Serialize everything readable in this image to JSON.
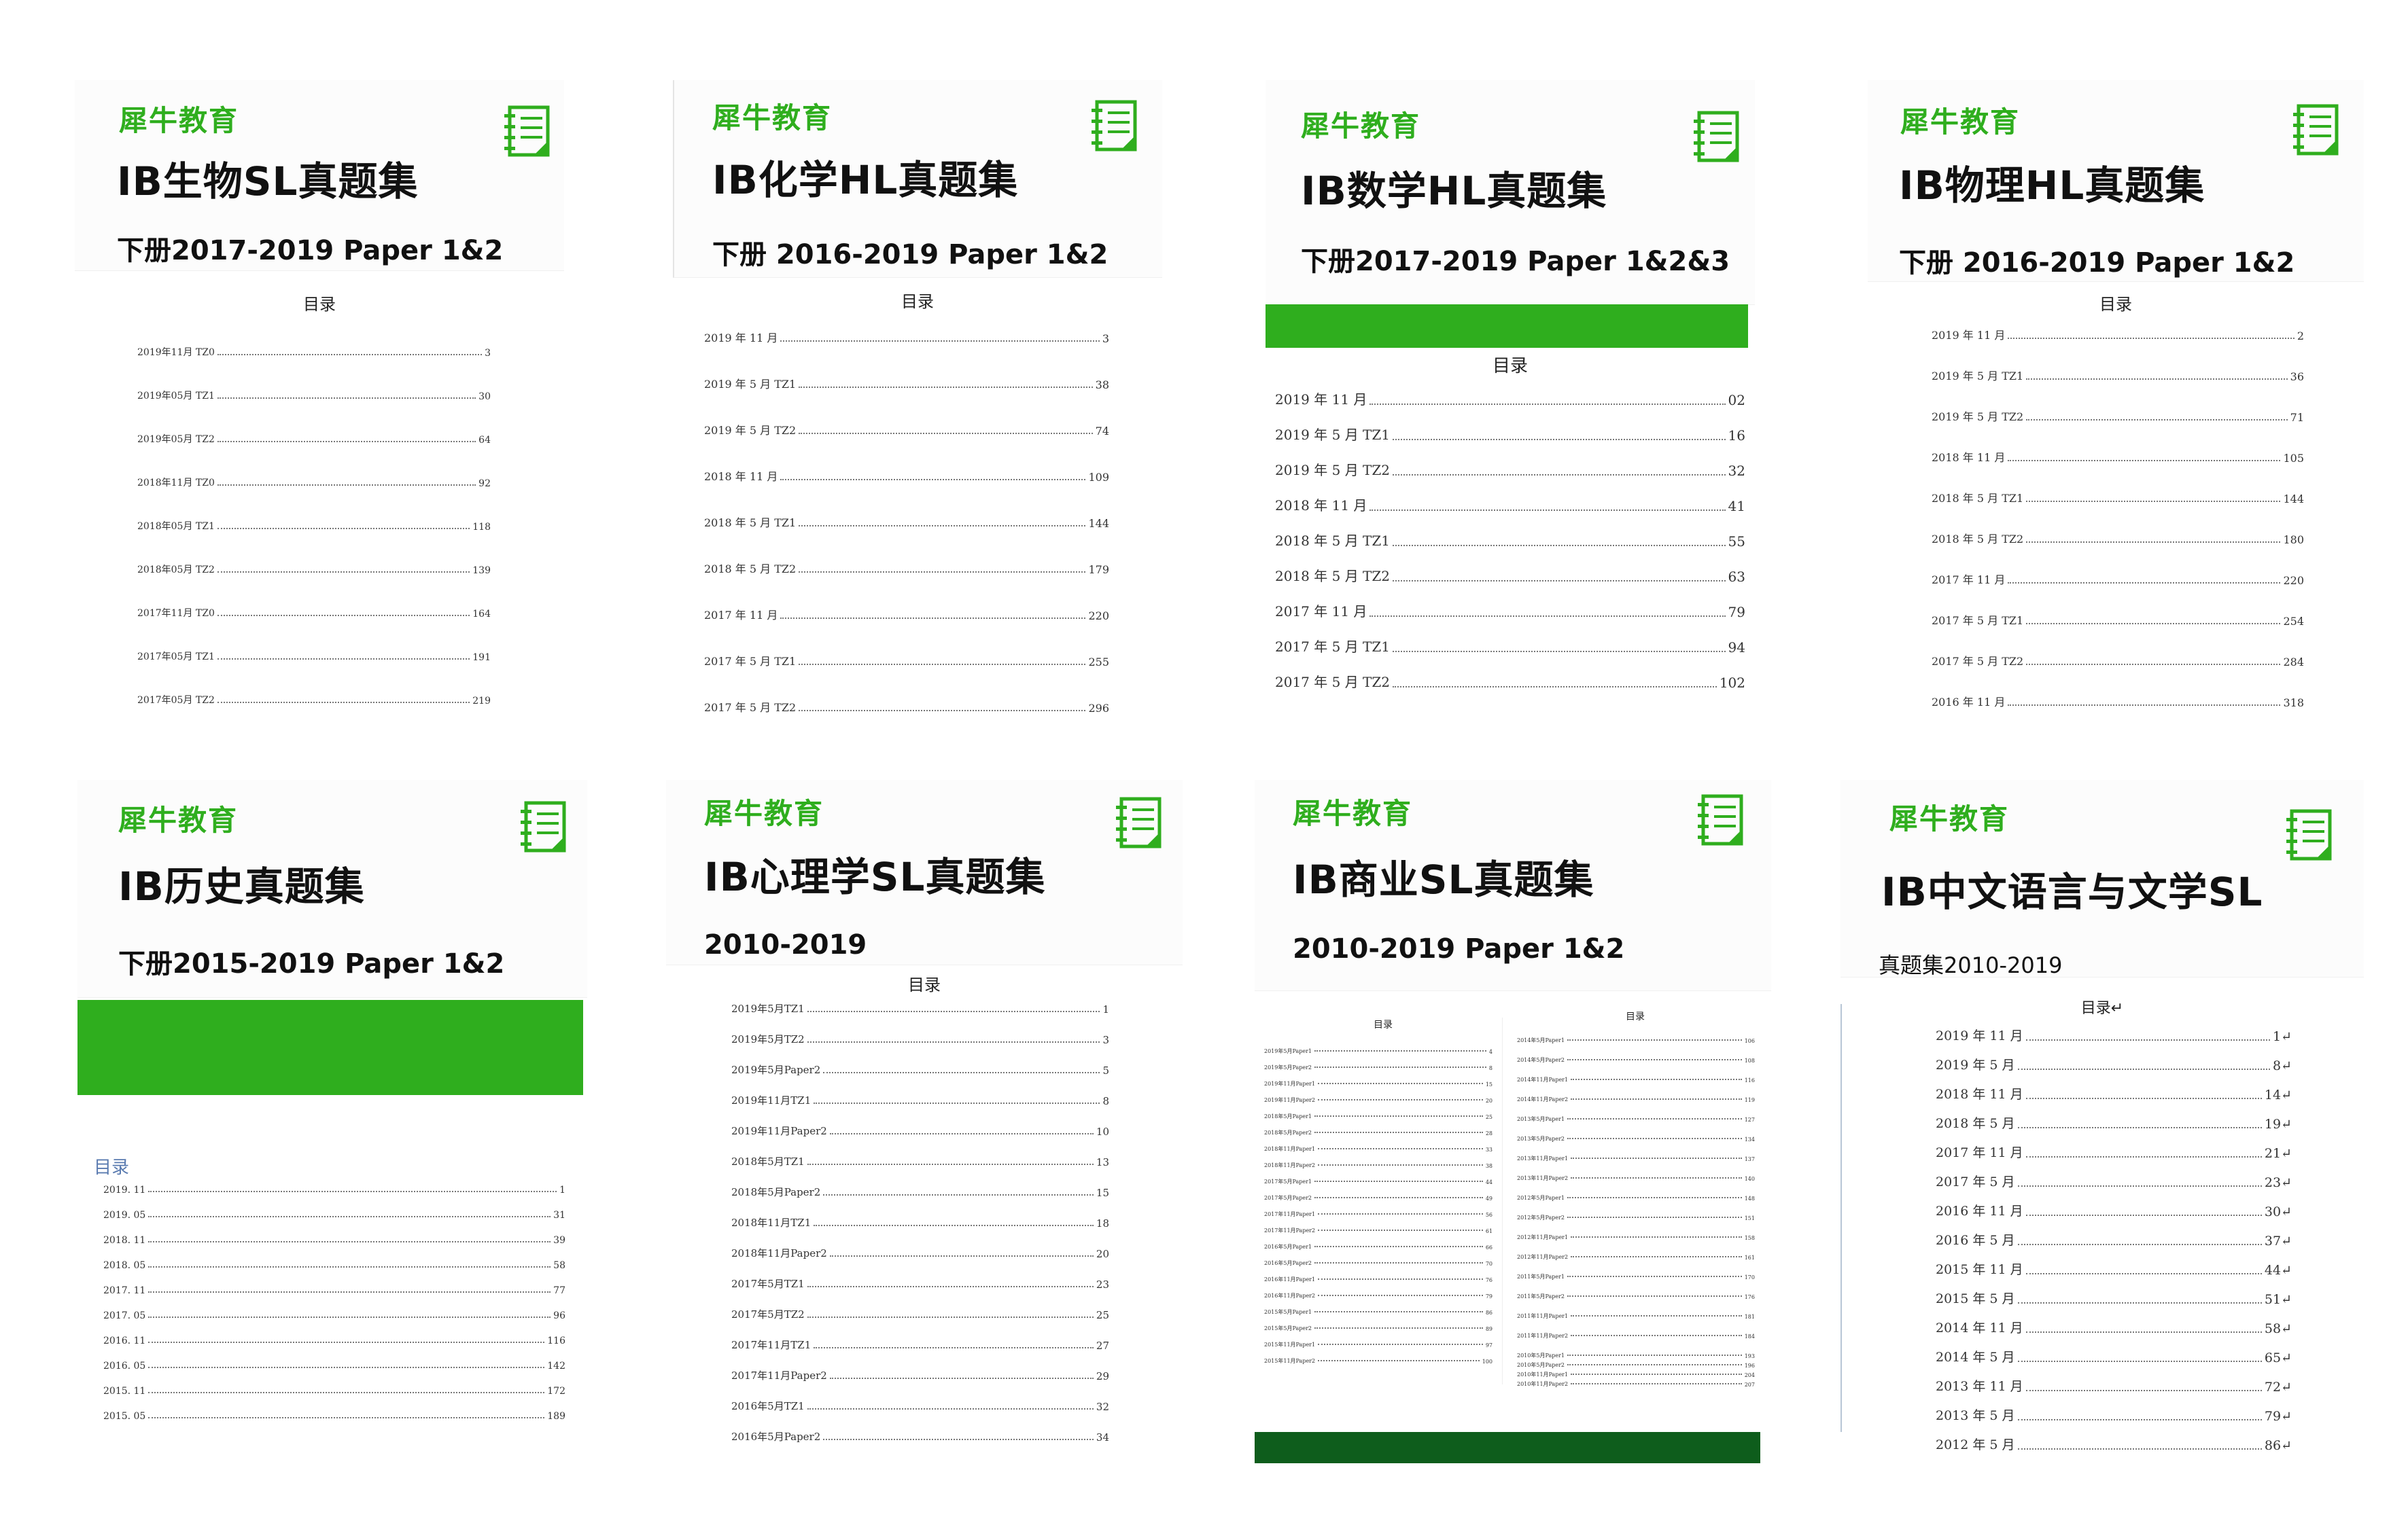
{
  "colors": {
    "brand_green": "#2fae1e",
    "dark_green": "#0e5d1c",
    "toc_header_blue": "#5a7bb0"
  },
  "icons": {
    "notebook": "notebook-icon"
  },
  "cards": [
    {
      "brand": "犀牛教育",
      "title": "IB生物SL真题集",
      "subtitle": "下册2017-2019 Paper 1&2",
      "toc_header": "目录",
      "toc": [
        {
          "label": "2019年11月 TZ0",
          "page": "3"
        },
        {
          "label": "2019年05月 TZ1",
          "page": "30"
        },
        {
          "label": "2019年05月 TZ2",
          "page": "64"
        },
        {
          "label": "2018年11月 TZ0",
          "page": "92"
        },
        {
          "label": "2018年05月 TZ1",
          "page": "118"
        },
        {
          "label": "2018年05月 TZ2",
          "page": "139"
        },
        {
          "label": "2017年11月 TZ0",
          "page": "164"
        },
        {
          "label": "2017年05月 TZ1",
          "page": "191"
        },
        {
          "label": "2017年05月 TZ2",
          "page": "219"
        }
      ]
    },
    {
      "brand": "犀牛教育",
      "title": "IB化学HL真题集",
      "subtitle": "下册 2016-2019  Paper 1&2",
      "toc_header": "目录",
      "toc": [
        {
          "label": "2019 年 11 月",
          "page": "3"
        },
        {
          "label": "2019 年 5 月 TZ1",
          "page": "38"
        },
        {
          "label": "2019 年 5 月 TZ2",
          "page": "74"
        },
        {
          "label": "2018 年 11 月",
          "page": "109"
        },
        {
          "label": "2018 年 5 月 TZ1",
          "page": "144"
        },
        {
          "label": "2018 年 5 月 TZ2",
          "page": "179"
        },
        {
          "label": "2017 年 11 月",
          "page": "220"
        },
        {
          "label": "2017 年 5 月 TZ1",
          "page": "255"
        },
        {
          "label": "2017 年 5 月 TZ2",
          "page": "296"
        }
      ]
    },
    {
      "brand": "犀牛教育",
      "title": "IB数学HL真题集",
      "subtitle": "下册2017-2019 Paper 1&2&3",
      "toc_header": "目录",
      "toc": [
        {
          "label": "2019 年 11 月",
          "page": "02"
        },
        {
          "label": "2019 年 5 月 TZ1",
          "page": "16"
        },
        {
          "label": "2019 年 5 月 TZ2",
          "page": "32"
        },
        {
          "label": "2018 年 11 月",
          "page": "41"
        },
        {
          "label": "2018 年 5 月 TZ1",
          "page": "55"
        },
        {
          "label": "2018 年 5 月 TZ2",
          "page": "63"
        },
        {
          "label": "2017 年 11 月",
          "page": "79"
        },
        {
          "label": "2017 年 5 月 TZ1",
          "page": "94"
        },
        {
          "label": "2017 年 5 月 TZ2",
          "page": "102"
        }
      ]
    },
    {
      "brand": "犀牛教育",
      "title": "IB物理HL真题集",
      "subtitle": "下册 2016-2019 Paper 1&2",
      "toc_header": "目录",
      "toc": [
        {
          "label": "2019 年 11 月",
          "page": "2"
        },
        {
          "label": "2019 年 5 月 TZ1",
          "page": "36"
        },
        {
          "label": "2019 年 5 月 TZ2",
          "page": "71"
        },
        {
          "label": "2018 年 11 月",
          "page": "105"
        },
        {
          "label": "2018 年 5 月 TZ1",
          "page": "144"
        },
        {
          "label": "2018 年 5 月 TZ2",
          "page": "180"
        },
        {
          "label": "2017 年 11 月",
          "page": "220"
        },
        {
          "label": "2017 年 5 月 TZ1",
          "page": "254"
        },
        {
          "label": "2017 年 5 月 TZ2",
          "page": "284"
        },
        {
          "label": "2016 年 11 月",
          "page": "318"
        }
      ]
    },
    {
      "brand": "犀牛教育",
      "title": "IB历史真题集",
      "subtitle": "下册2015-2019 Paper 1&2",
      "toc_header": "目录",
      "toc": [
        {
          "label": "2019. 11",
          "page": "1"
        },
        {
          "label": "2019. 05",
          "page": "31"
        },
        {
          "label": "2018. 11",
          "page": "39"
        },
        {
          "label": "2018. 05",
          "page": "58"
        },
        {
          "label": "2017. 11",
          "page": "77"
        },
        {
          "label": "2017. 05",
          "page": "96"
        },
        {
          "label": "2016. 11",
          "page": "116"
        },
        {
          "label": "2016. 05",
          "page": "142"
        },
        {
          "label": "2015. 11",
          "page": "172"
        },
        {
          "label": "2015. 05",
          "page": "189"
        }
      ]
    },
    {
      "brand": "犀牛教育",
      "title": "IB心理学SL真题集",
      "subtitle": "2010-2019",
      "toc_header": "目录",
      "toc": [
        {
          "label": "2019年5月TZ1",
          "page": "1"
        },
        {
          "label": "2019年5月TZ2",
          "page": "3"
        },
        {
          "label": "2019年5月Paper2",
          "page": "5"
        },
        {
          "label": "2019年11月TZ1",
          "page": "8"
        },
        {
          "label": "2019年11月Paper2",
          "page": "10"
        },
        {
          "label": "2018年5月TZ1",
          "page": "13"
        },
        {
          "label": "2018年5月Paper2",
          "page": "15"
        },
        {
          "label": "2018年11月TZ1",
          "page": "18"
        },
        {
          "label": "2018年11月Paper2",
          "page": "20"
        },
        {
          "label": "2017年5月TZ1",
          "page": "23"
        },
        {
          "label": "2017年5月TZ2",
          "page": "25"
        },
        {
          "label": "2017年11月TZ1",
          "page": "27"
        },
        {
          "label": "2017年11月Paper2",
          "page": "29"
        },
        {
          "label": "2016年5月TZ1",
          "page": "32"
        },
        {
          "label": "2016年5月Paper2",
          "page": "34"
        }
      ]
    },
    {
      "brand": "犀牛教育",
      "title": "IB商业SL真题集",
      "subtitle": "2010-2019 Paper 1&2",
      "toc_header": "目录",
      "toc_left": [
        {
          "label": "2019年5月Paper1",
          "page": "4"
        },
        {
          "label": "2019年5月Paper2",
          "page": "8"
        },
        {
          "label": "2019年11月Paper1",
          "page": "15"
        },
        {
          "label": "2019年11月Paper2",
          "page": "20"
        },
        {
          "label": "2018年5月Paper1",
          "page": "25"
        },
        {
          "label": "2018年5月Paper2",
          "page": "28"
        },
        {
          "label": "2018年11月Paper1",
          "page": "33"
        },
        {
          "label": "2018年11月Paper2",
          "page": "38"
        },
        {
          "label": "2017年5月Paper1",
          "page": "44"
        },
        {
          "label": "2017年5月Paper2",
          "page": "49"
        },
        {
          "label": "2017年11月Paper1",
          "page": "56"
        },
        {
          "label": "2017年11月Paper2",
          "page": "61"
        },
        {
          "label": "2016年5月Paper1",
          "page": "66"
        },
        {
          "label": "2016年5月Paper2",
          "page": "70"
        },
        {
          "label": "2016年11月Paper1",
          "page": "76"
        },
        {
          "label": "2016年11月Paper2",
          "page": "79"
        },
        {
          "label": "2015年5月Paper1",
          "page": "86"
        },
        {
          "label": "2015年5月Paper2",
          "page": "89"
        },
        {
          "label": "2015年11月Paper1",
          "page": "97"
        },
        {
          "label": "2015年11月Paper2",
          "page": "100"
        }
      ],
      "toc_right": [
        {
          "label": "2014年5月Paper1",
          "page": "106"
        },
        {
          "label": "2014年5月Paper2",
          "page": "108"
        },
        {
          "label": "2014年11月Paper1",
          "page": "116"
        },
        {
          "label": "2014年11月Paper2",
          "page": "119"
        },
        {
          "label": "2013年5月Paper1",
          "page": "127"
        },
        {
          "label": "2013年5月Paper2",
          "page": "134"
        },
        {
          "label": "2013年11月Paper1",
          "page": "137"
        },
        {
          "label": "2013年11月Paper2",
          "page": "140"
        },
        {
          "label": "2012年5月Paper1",
          "page": "148"
        },
        {
          "label": "2012年5月Paper2",
          "page": "151"
        },
        {
          "label": "2012年11月Paper1",
          "page": "158"
        },
        {
          "label": "2012年11月Paper2",
          "page": "161"
        },
        {
          "label": "2011年5月Paper1",
          "page": "170"
        },
        {
          "label": "2011年5月Paper2",
          "page": "176"
        },
        {
          "label": "2011年11月Paper1",
          "page": "181"
        },
        {
          "label": "2011年11月Paper2",
          "page": "184"
        },
        {
          "label": "2010年5月Paper1",
          "page": "193"
        },
        {
          "label": "2010年5月Paper2",
          "page": "196"
        },
        {
          "label": "2010年11月Paper1",
          "page": "204"
        },
        {
          "label": "2010年11月Paper2",
          "page": "207"
        }
      ]
    },
    {
      "brand": "犀牛教育",
      "title": "IB中文语言与文学SL",
      "subtitle": "真题集2010-2019",
      "toc_header": "目录↵",
      "toc": [
        {
          "label": "2019 年 11 月",
          "page": "1↵"
        },
        {
          "label": "2019 年 5 月",
          "page": "8↵"
        },
        {
          "label": "2018 年 11 月",
          "page": "14↵"
        },
        {
          "label": "2018 年 5 月",
          "page": "19↵"
        },
        {
          "label": "2017 年 11 月",
          "page": "21↵"
        },
        {
          "label": "2017 年 5 月",
          "page": "23↵"
        },
        {
          "label": "2016 年 11 月",
          "page": "30↵"
        },
        {
          "label": "2016 年 5 月",
          "page": "37↵"
        },
        {
          "label": "2015 年 11 月",
          "page": "44↵"
        },
        {
          "label": "2015 年 5 月",
          "page": "51↵"
        },
        {
          "label": "2014 年 11 月",
          "page": "58↵"
        },
        {
          "label": "2014 年 5 月",
          "page": "65↵"
        },
        {
          "label": "2013 年 11 月",
          "page": "72↵"
        },
        {
          "label": "2013 年 5 月",
          "page": "79↵"
        },
        {
          "label": "2012 年 5 月",
          "page": "86↵"
        }
      ]
    }
  ]
}
